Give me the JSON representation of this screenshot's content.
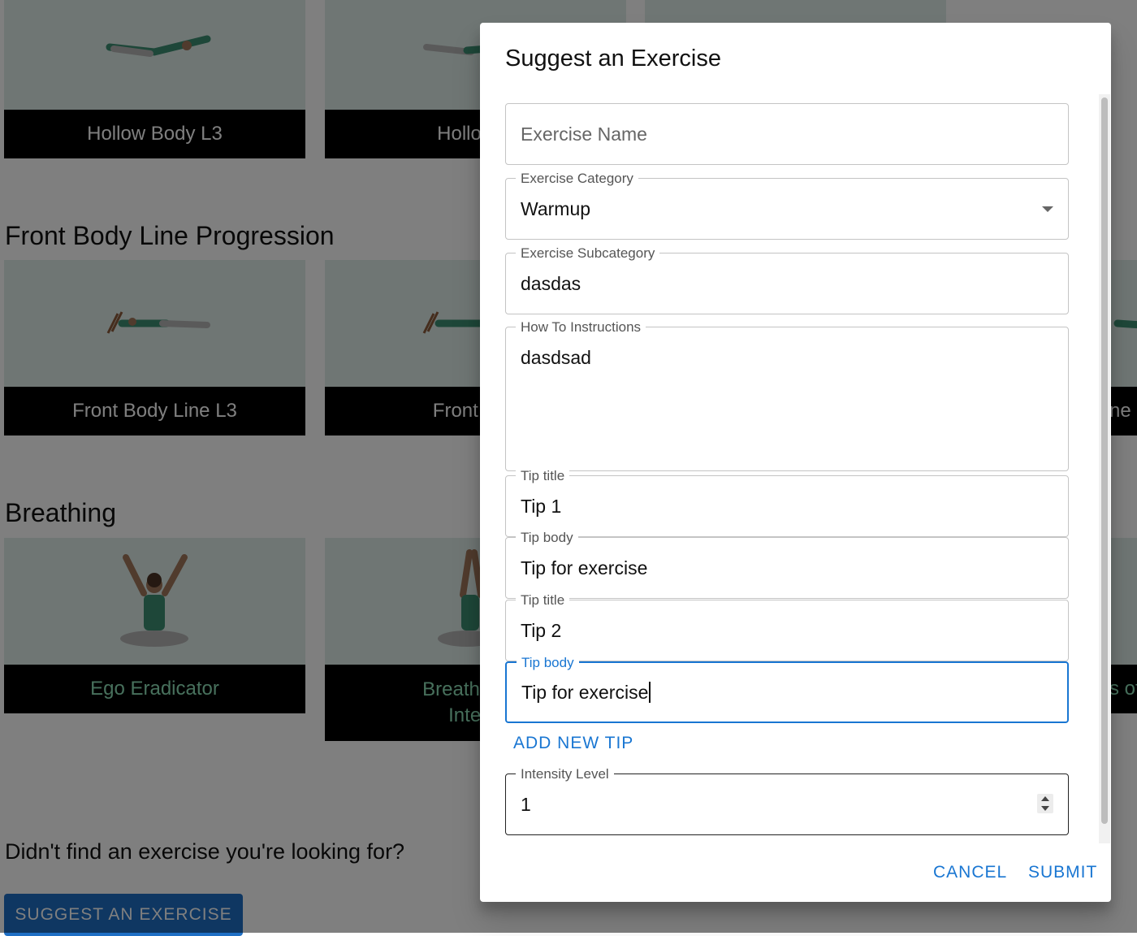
{
  "background": {
    "sections": [
      {
        "cards": [
          {
            "caption": "Hollow Body L3"
          },
          {
            "caption": "Hollow B"
          }
        ]
      },
      {
        "title": "Front Body Line Progression",
        "cards": [
          {
            "caption": "Front Body Line L3"
          },
          {
            "caption": "Front Bod"
          },
          {
            "caption": "ne C"
          }
        ]
      },
      {
        "title": "Breathing",
        "cards": [
          {
            "caption": "Ego Eradicator"
          },
          {
            "caption_line1": "Breaths of F",
            "caption_line2": "Interla"
          },
          {
            "caption": "s of"
          }
        ]
      }
    ],
    "prompt_text": "Didn't find an exercise you're looking for?",
    "suggest_button": "SUGGEST AN EXERCISE"
  },
  "dialog": {
    "title": "Suggest an Exercise",
    "exercise_name_placeholder": "Exercise Name",
    "category": {
      "label": "Exercise Category",
      "value": "Warmup"
    },
    "subcategory": {
      "label": "Exercise Subcategory",
      "value": "dasdas"
    },
    "instructions": {
      "label": "How To Instructions",
      "value": "dasdsad"
    },
    "tips": [
      {
        "title_label": "Tip title",
        "title_value": "Tip 1",
        "body_label": "Tip body",
        "body_value": "Tip for exercise"
      },
      {
        "title_label": "Tip title",
        "title_value": "Tip 2",
        "body_label": "Tip body",
        "body_value": "Tip for exercise"
      }
    ],
    "add_tip_button": "ADD NEW TIP",
    "intensity": {
      "label": "Intensity Level",
      "value": "1"
    },
    "cancel_button": "CANCEL",
    "submit_button": "SUBMIT"
  },
  "colors": {
    "accent": "#1976d2",
    "button_bg": "#1f6fc5",
    "card_thumb": "#dfece9"
  }
}
